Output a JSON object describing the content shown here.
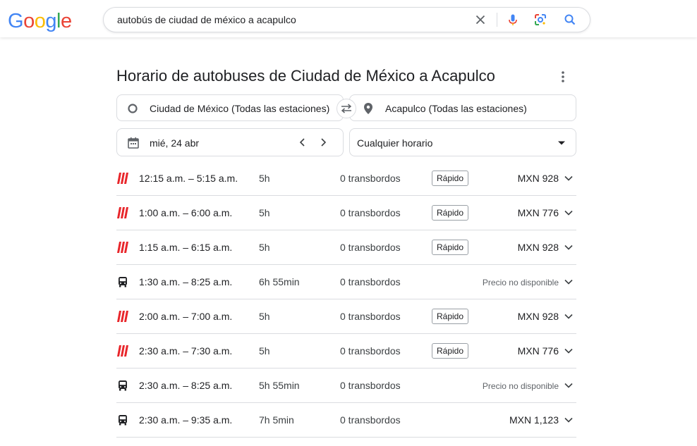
{
  "header": {
    "logo_letters": [
      "G",
      "o",
      "o",
      "g",
      "l",
      "e"
    ],
    "logo_colors": [
      "#4285F4",
      "#EA4335",
      "#FBBC05",
      "#4285F4",
      "#34A853",
      "#EA4335"
    ],
    "search_query": "autobús de ciudad de méxico a acapulco"
  },
  "widget": {
    "title": "Horario de autobuses de Ciudad de México a Acapulco",
    "origin": "Ciudad de México (Todas las estaciones)",
    "destination": "Acapulco (Todas las estaciones)",
    "date": "mié, 24 abr",
    "time_filter": "Cualquier horario"
  },
  "colors": {
    "operator_red": "#e8262b",
    "accent_blue": "#4285F4"
  },
  "results": [
    {
      "operator_icon": "red-bars-logo",
      "time": "12:15 a.m. – 5:15 a.m.",
      "duration": "5h",
      "transfers": "0 transbordos",
      "badge": "Rápido",
      "price": "MXN 928"
    },
    {
      "operator_icon": "red-bars-logo",
      "time": "1:00 a.m. – 6:00 a.m.",
      "duration": "5h",
      "transfers": "0 transbordos",
      "badge": "Rápido",
      "price": "MXN 776"
    },
    {
      "operator_icon": "red-bars-logo",
      "time": "1:15 a.m. – 6:15 a.m.",
      "duration": "5h",
      "transfers": "0 transbordos",
      "badge": "Rápido",
      "price": "MXN 928"
    },
    {
      "operator_icon": "bus-icon",
      "time": "1:30 a.m. – 8:25 a.m.",
      "duration": "6h 55min",
      "transfers": "0 transbordos",
      "badge": "",
      "price": "Precio no disponible"
    },
    {
      "operator_icon": "red-bars-logo",
      "time": "2:00 a.m. – 7:00 a.m.",
      "duration": "5h",
      "transfers": "0 transbordos",
      "badge": "Rápido",
      "price": "MXN 928"
    },
    {
      "operator_icon": "red-bars-logo",
      "time": "2:30 a.m. – 7:30 a.m.",
      "duration": "5h",
      "transfers": "0 transbordos",
      "badge": "Rápido",
      "price": "MXN 776"
    },
    {
      "operator_icon": "bus-icon",
      "time": "2:30 a.m. – 8:25 a.m.",
      "duration": "5h 55min",
      "transfers": "0 transbordos",
      "badge": "",
      "price": "Precio no disponible"
    },
    {
      "operator_icon": "bus-icon",
      "time": "2:30 a.m. – 9:35 a.m.",
      "duration": "7h 5min",
      "transfers": "0 transbordos",
      "badge": "",
      "price": "MXN 1,123"
    }
  ]
}
